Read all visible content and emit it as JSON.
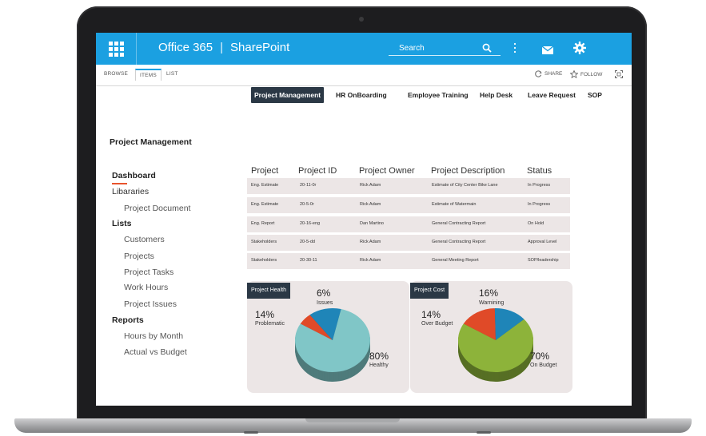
{
  "suitebar": {
    "product": "Office 365",
    "separator": "|",
    "site": "SharePoint",
    "search_label": "Search"
  },
  "ribbon": {
    "tabs": [
      "BROWSE",
      "ITEMS",
      "LIST"
    ],
    "active_tab": "ITEMS",
    "share_label": "SHARE",
    "follow_label": "FOLLOW"
  },
  "topnav": {
    "items": [
      "Project Management",
      "HR OnBoarding",
      "Employee Training",
      "Help Desk",
      "Leave Request",
      "SOP"
    ],
    "active": "Project Management"
  },
  "sidebar": {
    "heading": "Project Management",
    "items": [
      {
        "label": "Dashboard",
        "kind": "header-active"
      },
      {
        "label": "Libararies",
        "kind": "plain"
      },
      {
        "label": "Project Document",
        "kind": "sub"
      },
      {
        "label": "Lists",
        "kind": "bold"
      },
      {
        "label": "Customers",
        "kind": "sub"
      },
      {
        "label": "Projects",
        "kind": "sub"
      },
      {
        "label": "Project Tasks",
        "kind": "sub"
      },
      {
        "label": "Work Hours",
        "kind": "sub"
      },
      {
        "label": "Project Issues",
        "kind": "sub"
      },
      {
        "label": "Reports",
        "kind": "bold"
      },
      {
        "label": "Hours by Month",
        "kind": "sub"
      },
      {
        "label": "Actual vs Budget",
        "kind": "sub"
      }
    ]
  },
  "table": {
    "columns": [
      "Project",
      "Project ID",
      "Project Owner",
      "Project Description",
      "Status"
    ],
    "rows": [
      [
        "Eng. Estimate",
        "20-11-0r",
        "Rick Adam",
        "Estimate of City Center Bike Lane",
        "In Progress"
      ],
      [
        "Eng. Estimate",
        "20-5-0r",
        "Rick Adam",
        "Estimate of Watermain",
        "In Progress"
      ],
      [
        "Eng. Report",
        "20-16-eng",
        "Dan Martino",
        "General Contracting Report",
        "On Hold"
      ],
      [
        "Stakeholders",
        "20-5-dd",
        "Rick Adam",
        "General Contracting Report",
        "Approval Level"
      ],
      [
        "Stakeholders",
        "20-30-11",
        "Rick Adam",
        "General Meeting Report",
        "SOP/leadership"
      ]
    ]
  },
  "charts": [
    {
      "title": "Project Health",
      "slices": [
        {
          "pct": "6%",
          "name": "Issues",
          "value": 6,
          "color": "#e04a28"
        },
        {
          "pct": "14%",
          "name": "Problematic",
          "value": 14,
          "color": "#1f85b8"
        },
        {
          "pct": "80%",
          "name": "Healthy",
          "value": 80,
          "color": "#80c6c7"
        }
      ]
    },
    {
      "title": "Project Cost",
      "slices": [
        {
          "pct": "16%",
          "name": "Warnining",
          "value": 16,
          "color": "#e04a28"
        },
        {
          "pct": "14%",
          "name": "Over Budget",
          "value": 14,
          "color": "#1f85b8"
        },
        {
          "pct": "70%",
          "name": "On Budget",
          "value": 70,
          "color": "#8db33a"
        }
      ]
    }
  ],
  "colors": {
    "suitebar": "#1ba0e1",
    "nav_active_bg": "#2b3845",
    "accent_underline": "#e8542d",
    "row_bg": "#ece6e6"
  }
}
